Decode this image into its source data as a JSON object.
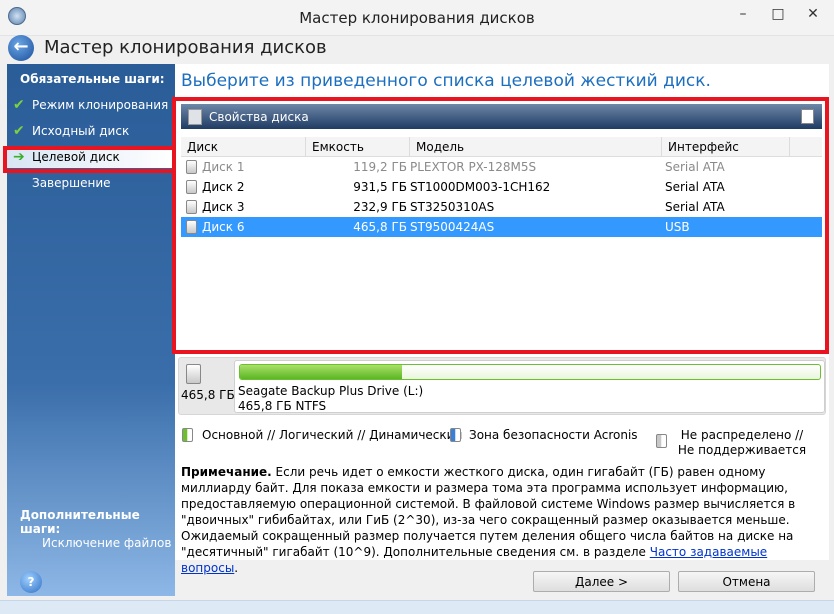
{
  "window": {
    "title": "Мастер клонирования дисков",
    "controls": [
      "–",
      "□",
      "✕"
    ]
  },
  "header": {
    "title": "Мастер клонирования дисков"
  },
  "sidebar": {
    "required_heading": "Обязательные шаги:",
    "items": [
      {
        "label": "Режим клонирования",
        "state": "done"
      },
      {
        "label": "Исходный диск",
        "state": "done"
      },
      {
        "label": "Целевой диск",
        "state": "current"
      },
      {
        "label": "Завершение",
        "state": "pending"
      }
    ],
    "optional_heading": "Дополнительные шаги:",
    "optional_items": [
      {
        "label": "Исключение файлов"
      }
    ]
  },
  "main": {
    "heading": "Выберите из приведенного списка целевой жесткий диск.",
    "properties_label": "Свойства диска",
    "columns": [
      "Диск",
      "Емкость",
      "Модель",
      "Интерфейс"
    ],
    "rows": [
      {
        "disk": "Диск 1",
        "capacity": "119,2 ГБ",
        "model": "PLEXTOR PX-128M5S",
        "interface": "Serial ATA",
        "state": "disabled"
      },
      {
        "disk": "Диск 2",
        "capacity": "931,5 ГБ",
        "model": "ST1000DM003-1CH162",
        "interface": "Serial ATA",
        "state": "normal"
      },
      {
        "disk": "Диск 3",
        "capacity": "232,9 ГБ",
        "model": "ST3250310AS",
        "interface": "Serial ATA",
        "state": "normal"
      },
      {
        "disk": "Диск 6",
        "capacity": "465,8 ГБ",
        "model": "ST9500424AS",
        "interface": "USB",
        "state": "selected"
      }
    ],
    "disk_panel": {
      "size": "465,8 ГБ",
      "volume_name": "Seagate Backup Plus Drive (L:)",
      "volume_info": "465,8 ГБ  NTFS",
      "used_percent": 28
    },
    "legend": [
      {
        "label": "Основной // Логический // Динамический",
        "color": "#6cc02e"
      },
      {
        "label": "Зона безопасности Acronis",
        "color": "#3a7fd6"
      },
      {
        "label": "Не распределено // Не поддерживается",
        "color": "#c8c8c8"
      }
    ],
    "note": {
      "bold": "Примечание.",
      "text": " Если речь идет о емкости жесткого диска, один гигабайт (ГБ) равен одному миллиарду байт. Для показа емкости и размера тома эта программа использует информацию, предоставляемую операционной системой. В файловой системе Windows размер вычисляется в \"двоичных\" гибибайтах, или ГиБ (2^30), из-за чего сокращенный размер оказывается меньше. Ожидаемый сокращенный размер получается путем деления общего числа байтов на диске на \"десятичный\" гигабайт (10^9). Дополнительные сведения см. в разделе ",
      "link": "Часто задаваемые вопросы",
      "end": "."
    }
  },
  "footer": {
    "help": "?",
    "next": "Далее >",
    "cancel": "Отмена"
  },
  "colors": {
    "accent": "#1c6fbf",
    "highlight": "#e8141f",
    "selection": "#3399ff"
  }
}
